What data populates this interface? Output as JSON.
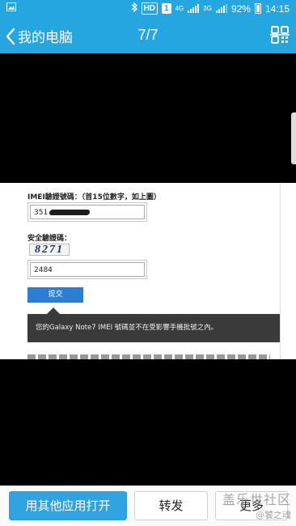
{
  "statusbar": {
    "bluetooth_icon": "bluetooth-icon",
    "hd_badge": "HD",
    "sim_badge": "1",
    "net1": "4G",
    "net2": "3G",
    "battery_percent": "92%",
    "time": "14:15"
  },
  "titlebar": {
    "back_label": "我的电脑",
    "pager": "7/7",
    "scan_icon": "qr-scan-icon"
  },
  "screenshot_content": {
    "imei_label": "IMEI驗證號碼：（首15位數字，如上圖）",
    "imei_value": "351",
    "security_label": "安全驗證碼：",
    "captcha_text": "8271",
    "captcha_value": "2484",
    "submit_label": "提交",
    "toast_message": "您的Galaxy Note7 IMEI 號碼並不在受影響手機批號之內。"
  },
  "bottombar": {
    "open_with": "用其他应用打开",
    "forward": "转发",
    "more": "更多"
  },
  "watermark": {
    "main": "盖乐世社区",
    "sub": "@饕之魂"
  },
  "colors": {
    "accent": "#26a6e0",
    "primary_button": "#2ea3e0",
    "submit_button": "#2a7fd4",
    "toast_bg": "#3a3a3a"
  }
}
